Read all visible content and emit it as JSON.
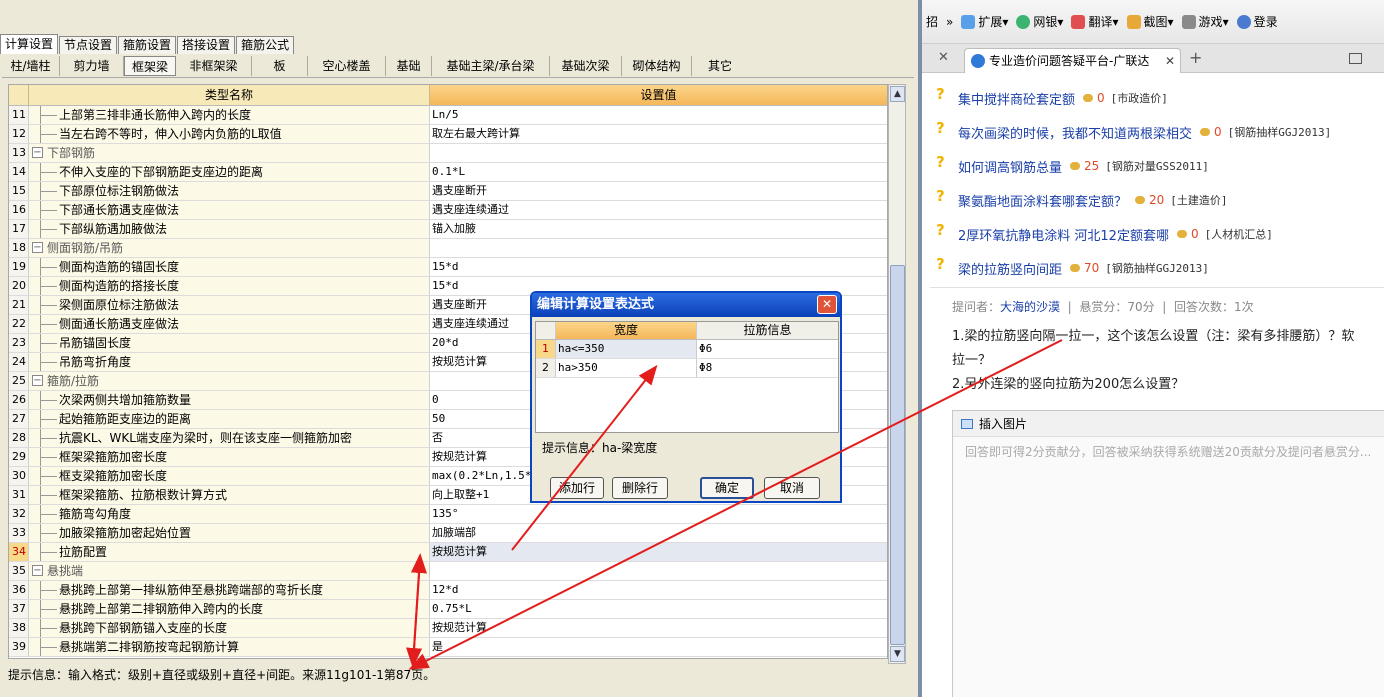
{
  "left": {
    "main_tabs": [
      "计算设置",
      "节点设置",
      "箍筋设置",
      "搭接设置",
      "箍筋公式"
    ],
    "category_tabs": [
      "柱/墙柱",
      "剪力墙",
      "框架梁",
      "非框架梁",
      "板",
      "空心楼盖",
      "基础",
      "基础主梁/承台梁",
      "基础次梁",
      "砌体结构",
      "其它"
    ],
    "header": {
      "name": "类型名称",
      "value": "设置值"
    },
    "rows": [
      {
        "num": "11",
        "name": "上部第三排非通长筋伸入跨内的长度",
        "value": "Ln/5"
      },
      {
        "num": "12",
        "name": "当左右跨不等时，伸入小跨内负筋的L取值",
        "value": "取左右最大跨计算"
      },
      {
        "num": "13",
        "name": "下部钢筋",
        "value": "",
        "group": true
      },
      {
        "num": "14",
        "name": "不伸入支座的下部钢筋距支座边的距离",
        "value": "0.1*L"
      },
      {
        "num": "15",
        "name": "下部原位标注钢筋做法",
        "value": "遇支座断开"
      },
      {
        "num": "16",
        "name": "下部通长筋遇支座做法",
        "value": "遇支座连续通过"
      },
      {
        "num": "17",
        "name": "下部纵筋遇加腋做法",
        "value": "锚入加腋"
      },
      {
        "num": "18",
        "name": "侧面钢筋/吊筋",
        "value": "",
        "group": true
      },
      {
        "num": "19",
        "name": "侧面构造筋的锚固长度",
        "value": "15*d"
      },
      {
        "num": "20",
        "name": "侧面构造筋的搭接长度",
        "value": "15*d"
      },
      {
        "num": "21",
        "name": "梁侧面原位标注筋做法",
        "value": "遇支座断开"
      },
      {
        "num": "22",
        "name": "侧面通长筋遇支座做法",
        "value": "遇支座连续通过"
      },
      {
        "num": "23",
        "name": "吊筋锚固长度",
        "value": "20*d"
      },
      {
        "num": "24",
        "name": "吊筋弯折角度",
        "value": "按规范计算"
      },
      {
        "num": "25",
        "name": "箍筋/拉筋",
        "value": "",
        "group": true
      },
      {
        "num": "26",
        "name": "次梁两侧共增加箍筋数量",
        "value": "0"
      },
      {
        "num": "27",
        "name": "起始箍筋距支座边的距离",
        "value": "50"
      },
      {
        "num": "28",
        "name": "抗震KL、WKL端支座为梁时，则在该支座一侧箍筋加密",
        "value": "否"
      },
      {
        "num": "29",
        "name": "框架梁箍筋加密长度",
        "value": "按规范计算"
      },
      {
        "num": "30",
        "name": "框支梁箍筋加密长度",
        "value": "max(0.2*Ln,1.5*hb"
      },
      {
        "num": "31",
        "name": "框架梁箍筋、拉筋根数计算方式",
        "value": "向上取整+1"
      },
      {
        "num": "32",
        "name": "箍筋弯勾角度",
        "value": "135°"
      },
      {
        "num": "33",
        "name": "加腋梁箍筋加密起始位置",
        "value": "加腋端部"
      },
      {
        "num": "34",
        "name": "拉筋配置",
        "value": "按规范计算",
        "selected": true
      },
      {
        "num": "35",
        "name": "悬挑端",
        "value": "",
        "group": true
      },
      {
        "num": "36",
        "name": "悬挑跨上部第一排纵筋伸至悬挑跨端部的弯折长度",
        "value": "12*d"
      },
      {
        "num": "37",
        "name": "悬挑跨上部第二排钢筋伸入跨内的长度",
        "value": "0.75*L"
      },
      {
        "num": "38",
        "name": "悬挑跨下部钢筋锚入支座的长度",
        "value": "按规范计算"
      },
      {
        "num": "39",
        "name": "悬挑端第二排钢筋按弯起钢筋计算",
        "value": "是"
      }
    ],
    "status": "提示信息：输入格式：级别+直径或级别+直径+间距。来源11g101-1第87页。"
  },
  "dialog": {
    "title": "编辑计算设置表达式",
    "close": "✕",
    "col1": "宽度",
    "col2": "拉筋信息",
    "rows": [
      {
        "num": "1",
        "width": "ha<=350",
        "info": "Φ6"
      },
      {
        "num": "2",
        "width": "ha>350",
        "info": "Φ8"
      }
    ],
    "hint": "提示信息：ha-梁宽度",
    "btn_add": "添加行",
    "btn_delete": "删除行",
    "btn_ok": "确定",
    "btn_cancel": "取消"
  },
  "right": {
    "toolbar": [
      "招",
      "»",
      "扩展",
      "网银",
      "翻译",
      "截图",
      "游戏",
      "登录"
    ],
    "tab_title": "专业造价问题答疑平台-广联达",
    "questions": [
      {
        "title": "集中搅拌商砼套定额",
        "score": "0",
        "cat": "[市政造价]"
      },
      {
        "title": "每次画梁的时候，我都不知道两根梁相交",
        "score": "0",
        "cat": "[钢筋抽样GGJ2013]"
      },
      {
        "title": "如何调高钢筋总量",
        "score": "25",
        "cat": "[钢筋对量GSS2011]"
      },
      {
        "title": "聚氨酯地面涂料套哪套定额？",
        "score": "20",
        "cat": "[土建造价]"
      },
      {
        "title": "2厚环氧抗静电涂料 河北12定额套哪",
        "score": "0",
        "cat": "[人材机汇总]"
      },
      {
        "title": "梁的拉筋竖向间距",
        "score": "70",
        "cat": "[钢筋抽样GGJ2013]"
      }
    ],
    "meta": {
      "asker_label": "提问者：",
      "asker": "大海的沙漠",
      "reward": "悬赏分：70分",
      "answers": "回答次数：1次"
    },
    "question_text": [
      "1.梁的拉筋竖向隔一拉一，这个该怎么设置（注：梁有多排腰筋）？软",
      "拉一？",
      "2.另外连梁的竖向拉筋为200怎么设置？"
    ],
    "insert_image": "插入图片",
    "answer_placeholder": "回答即可得2分贡献分，回答被采纳获得系统赠送20贡献分及提问者悬赏分..."
  },
  "colors": {
    "arrow": "#e31c1c",
    "title_bar": "#0a46c4",
    "header_orange": "#f5b75a",
    "link": "#1a3fa8"
  }
}
